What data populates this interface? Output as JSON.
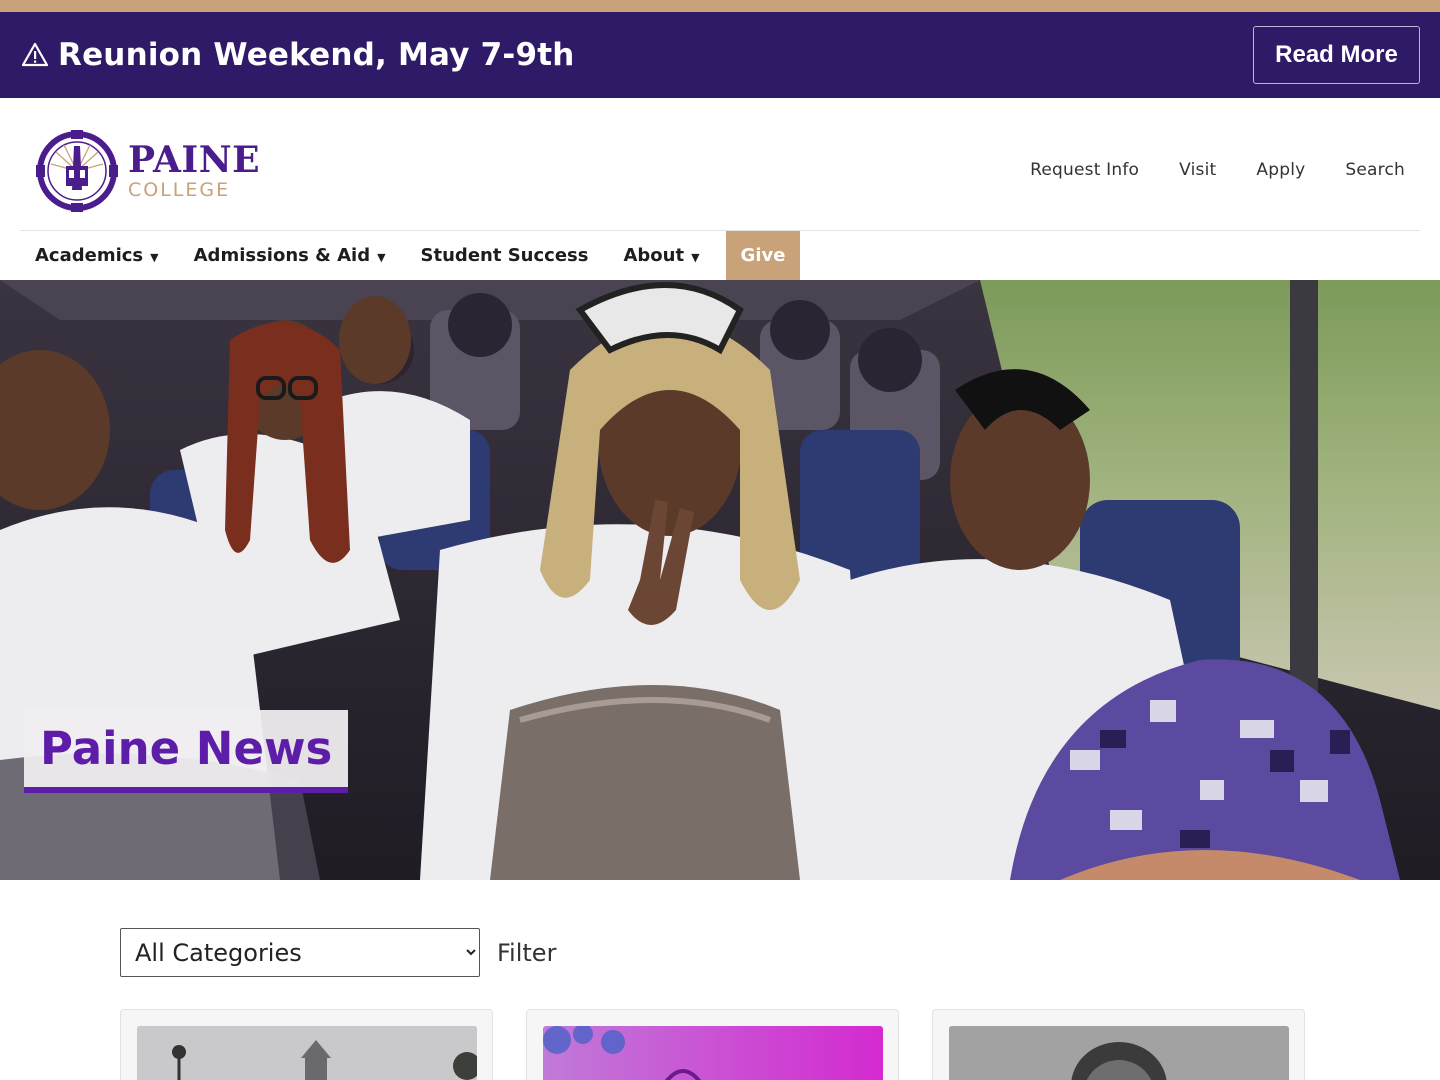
{
  "colors": {
    "accent_gold": "#c9a27a",
    "brand_purple": "#2e1a66",
    "title_purple": "#5d1da8"
  },
  "alert": {
    "icon": "warning-icon",
    "text": "Reunion Weekend, May 7-9th",
    "button_label": "Read More"
  },
  "logo": {
    "name": "PAINE",
    "sub": "COLLEGE"
  },
  "utility_nav": [
    "Request Info",
    "Visit",
    "Apply",
    "Search"
  ],
  "main_nav": [
    {
      "label": "Academics",
      "dropdown": true
    },
    {
      "label": "Admissions & Aid",
      "dropdown": true
    },
    {
      "label": "Student Success",
      "dropdown": false
    },
    {
      "label": "About",
      "dropdown": true
    },
    {
      "label": "Give",
      "dropdown": false
    }
  ],
  "hero": {
    "title": "Paine News"
  },
  "filter": {
    "selected": "All Categories",
    "label": "Filter"
  }
}
